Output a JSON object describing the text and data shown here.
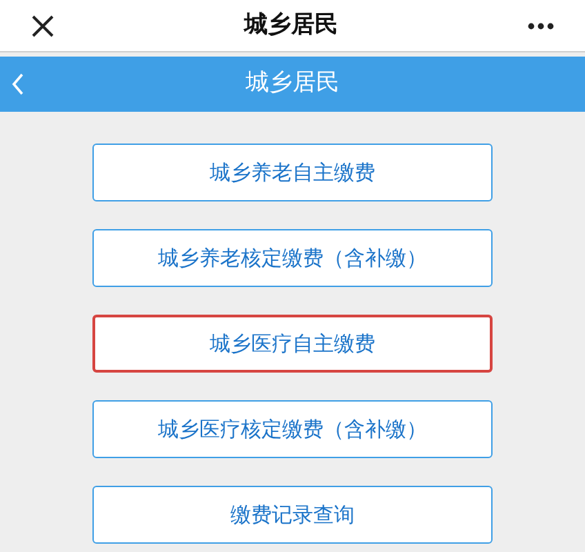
{
  "top_bar": {
    "title": "城乡居民"
  },
  "header": {
    "title": "城乡居民"
  },
  "buttons": [
    {
      "label": "城乡养老自主缴费",
      "selected": false
    },
    {
      "label": "城乡养老核定缴费（含补缴）",
      "selected": false
    },
    {
      "label": "城乡医疗自主缴费",
      "selected": true
    },
    {
      "label": "城乡医疗核定缴费（含补缴）",
      "selected": false
    },
    {
      "label": "缴费记录查询",
      "selected": false
    }
  ]
}
